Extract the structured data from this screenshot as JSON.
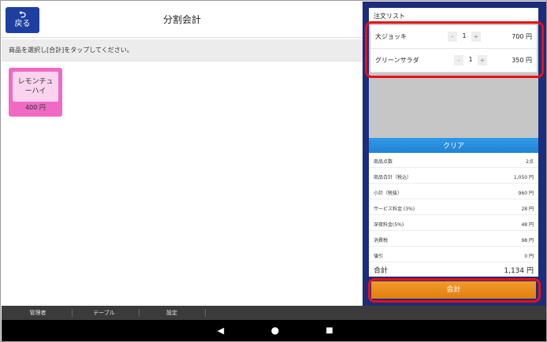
{
  "header": {
    "back_label": "戻る",
    "title": "分割会計"
  },
  "instruction": "商品を選択し[合計]をタップしてください。",
  "product": {
    "name_line1": "レモンチュ",
    "name_line2": "ーハイ",
    "price": "400 円",
    "color": "#f06ac4"
  },
  "order_list": {
    "title": "注文リスト",
    "items": [
      {
        "name": "大ジョッキ",
        "minus": "-",
        "qty": "1",
        "plus": "+",
        "amount": "700 円"
      },
      {
        "name": "グリーンサラダ",
        "minus": "-",
        "qty": "1",
        "plus": "+",
        "amount": "350 円"
      }
    ],
    "clear_label": "クリア"
  },
  "summary": {
    "rows": [
      {
        "label": "商品点数",
        "value": "2点"
      },
      {
        "label": "商品合計（税込）",
        "value": "1,050 円"
      },
      {
        "label": "小計（税抜）",
        "value": "960 円"
      },
      {
        "label": "サービス料金 (3%)",
        "value": "28 円"
      },
      {
        "label": "深夜料金(5%)",
        "value": "48 円"
      },
      {
        "label": "消費税",
        "value": "98 円"
      },
      {
        "label": "値引",
        "value": "0 円"
      }
    ],
    "total_label": "合計",
    "total_value": "1,134 円"
  },
  "checkout_label": "会計",
  "bottom_nav": {
    "items": [
      "管理者",
      "テーブル",
      "設定"
    ]
  },
  "android_nav": {
    "back": "◀",
    "home": "●",
    "recent": "■"
  },
  "colors": {
    "accent_blue": "#1d2c7b",
    "back_button": "#1e3fa0",
    "clear_button": "#1e7fd0",
    "checkout_button": "#f39a2a",
    "highlight": "#e8101a"
  }
}
